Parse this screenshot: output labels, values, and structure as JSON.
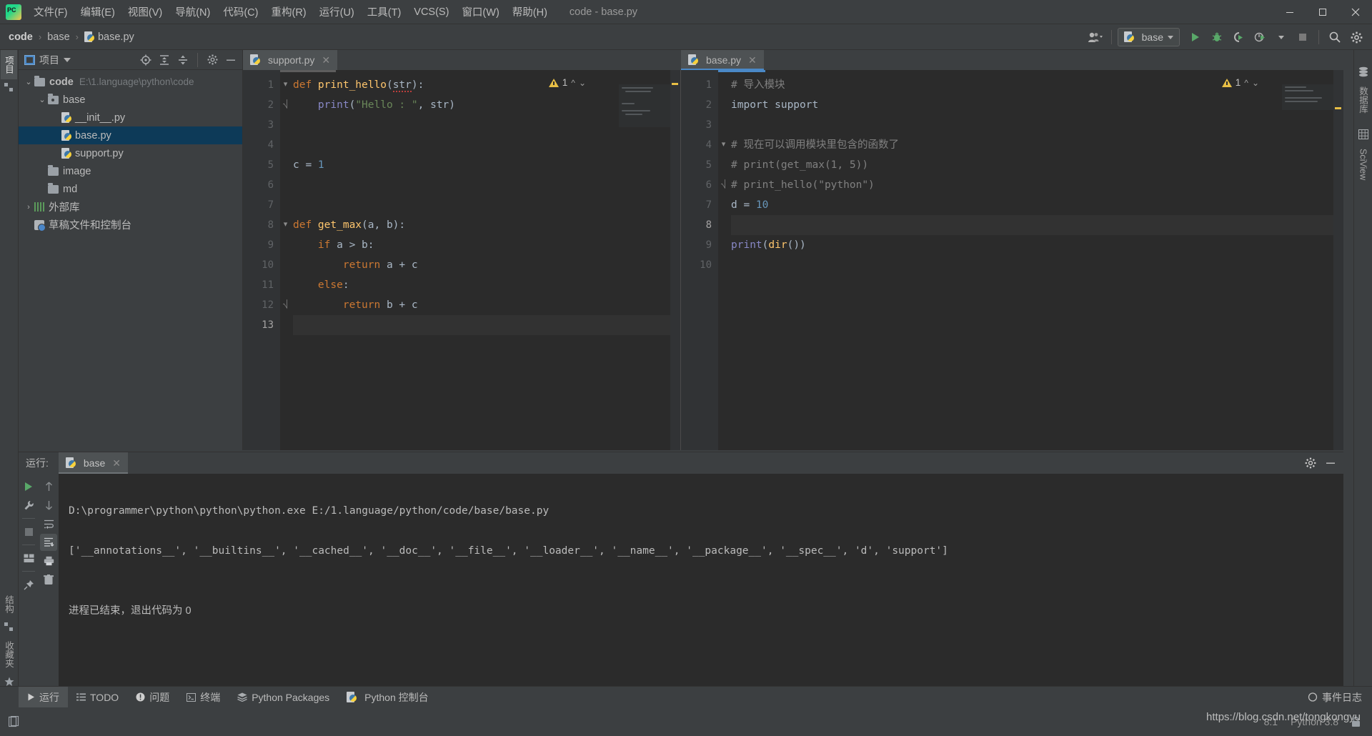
{
  "window": {
    "title": "code - base.py",
    "app_icon": "pycharm-logo-icon",
    "minimize_label": "–",
    "maximize_label": "❐",
    "close_label": "✕"
  },
  "menu": {
    "items": [
      {
        "label": "文件(F)",
        "name": "menu-file"
      },
      {
        "label": "编辑(E)",
        "name": "menu-edit"
      },
      {
        "label": "视图(V)",
        "name": "menu-view"
      },
      {
        "label": "导航(N)",
        "name": "menu-navigate"
      },
      {
        "label": "代码(C)",
        "name": "menu-code"
      },
      {
        "label": "重构(R)",
        "name": "menu-refactor"
      },
      {
        "label": "运行(U)",
        "name": "menu-run"
      },
      {
        "label": "工具(T)",
        "name": "menu-tools"
      },
      {
        "label": "VCS(S)",
        "name": "menu-vcs"
      },
      {
        "label": "窗口(W)",
        "name": "menu-window"
      },
      {
        "label": "帮助(H)",
        "name": "menu-help"
      }
    ]
  },
  "breadcrumb": {
    "root": "code",
    "folder": "base",
    "file": "base.py",
    "separator": "›"
  },
  "toolbar": {
    "run_config_label": "base",
    "buttons": [
      {
        "name": "run-button",
        "title": "Run"
      },
      {
        "name": "debug-button",
        "title": "Debug"
      },
      {
        "name": "run-with-coverage-button",
        "title": "Run with Coverage"
      },
      {
        "name": "profile-button",
        "title": "Profile"
      },
      {
        "name": "stop-button",
        "title": "Stop"
      },
      {
        "name": "search-everywhere-button",
        "title": "Search Everywhere"
      },
      {
        "name": "settings-button",
        "title": "Settings"
      }
    ]
  },
  "project_panel": {
    "title": "项目",
    "tree": [
      {
        "label": "code",
        "path": "E:\\1.language\\python\\code",
        "type": "root",
        "indent": 0,
        "expanded": true,
        "bold": true,
        "selected": false
      },
      {
        "label": "base",
        "path": "",
        "type": "source-folder",
        "indent": 1,
        "expanded": true,
        "bold": false,
        "selected": false
      },
      {
        "label": "__init__.py",
        "path": "",
        "type": "python-file",
        "indent": 2,
        "expanded": null,
        "bold": false,
        "selected": false
      },
      {
        "label": "base.py",
        "path": "",
        "type": "python-file",
        "indent": 2,
        "expanded": null,
        "bold": false,
        "selected": true
      },
      {
        "label": "support.py",
        "path": "",
        "type": "python-file",
        "indent": 2,
        "expanded": null,
        "bold": false,
        "selected": false
      },
      {
        "label": "image",
        "path": "",
        "type": "folder",
        "indent": 1,
        "expanded": null,
        "bold": false,
        "selected": false
      },
      {
        "label": "md",
        "path": "",
        "type": "folder",
        "indent": 1,
        "expanded": null,
        "bold": false,
        "selected": false
      },
      {
        "label": "外部库",
        "path": "",
        "type": "library",
        "indent": 0,
        "expanded": false,
        "bold": false,
        "selected": false
      },
      {
        "label": "草稿文件和控制台",
        "path": "",
        "type": "scratch",
        "indent": 0,
        "expanded": null,
        "bold": false,
        "selected": false
      }
    ]
  },
  "left_strip": {
    "project_tab": "项目",
    "structure_tab": "结构",
    "favorites_tab": "收藏夹"
  },
  "right_strip": {
    "database_tab": "数据库",
    "sciview_tab": "SciView"
  },
  "editor": {
    "tabs": [
      {
        "label": "support.py",
        "name": "tab-support-py",
        "active": false
      },
      {
        "label": "base.py",
        "name": "tab-base-py",
        "active": true
      }
    ],
    "left_pane": {
      "filename": "support.py",
      "warning_count": "1",
      "line_count": 13,
      "lines": [
        {
          "n": 1,
          "tokens": [
            {
              "t": "def ",
              "c": "k"
            },
            {
              "t": "print_hello",
              "c": "fn"
            },
            {
              "t": "(",
              "c": "d"
            },
            {
              "t": "str",
              "c": "err"
            },
            {
              "t": "):",
              "c": "d"
            }
          ]
        },
        {
          "n": 2,
          "tokens": [
            {
              "t": "    ",
              "c": "d"
            },
            {
              "t": "print",
              "c": "blt"
            },
            {
              "t": "(",
              "c": "d"
            },
            {
              "t": "\"Hello : \"",
              "c": "s"
            },
            {
              "t": ", str)",
              "c": "d"
            }
          ]
        },
        {
          "n": 3,
          "tokens": []
        },
        {
          "n": 4,
          "tokens": []
        },
        {
          "n": 5,
          "tokens": [
            {
              "t": "c = ",
              "c": "d"
            },
            {
              "t": "1",
              "c": "n"
            }
          ]
        },
        {
          "n": 6,
          "tokens": []
        },
        {
          "n": 7,
          "tokens": []
        },
        {
          "n": 8,
          "tokens": [
            {
              "t": "def ",
              "c": "k"
            },
            {
              "t": "get_max",
              "c": "fn"
            },
            {
              "t": "(a, b):",
              "c": "d"
            }
          ]
        },
        {
          "n": 9,
          "tokens": [
            {
              "t": "    ",
              "c": "d"
            },
            {
              "t": "if ",
              "c": "k"
            },
            {
              "t": "a > b:",
              "c": "d"
            }
          ]
        },
        {
          "n": 10,
          "tokens": [
            {
              "t": "        ",
              "c": "d"
            },
            {
              "t": "return ",
              "c": "k"
            },
            {
              "t": "a + c",
              "c": "d"
            }
          ]
        },
        {
          "n": 11,
          "tokens": [
            {
              "t": "    ",
              "c": "d"
            },
            {
              "t": "else",
              "c": "k"
            },
            {
              "t": ":",
              "c": "d"
            }
          ]
        },
        {
          "n": 12,
          "tokens": [
            {
              "t": "        ",
              "c": "d"
            },
            {
              "t": "return ",
              "c": "k"
            },
            {
              "t": "b + c",
              "c": "d"
            }
          ]
        },
        {
          "n": 13,
          "tokens": []
        }
      ],
      "current_line": 13
    },
    "right_pane": {
      "filename": "base.py",
      "warning_count": "1",
      "line_count": 10,
      "lines": [
        {
          "n": 1,
          "tokens": [
            {
              "t": "# 导入模块",
              "c": "c"
            }
          ]
        },
        {
          "n": 2,
          "tokens": [
            {
              "t": "import support",
              "c": "d"
            }
          ]
        },
        {
          "n": 3,
          "tokens": []
        },
        {
          "n": 4,
          "tokens": [
            {
              "t": "# 现在可以调用模块里包含的函数了",
              "c": "c"
            }
          ]
        },
        {
          "n": 5,
          "tokens": [
            {
              "t": "# print(get_max(1, 5))",
              "c": "c"
            }
          ]
        },
        {
          "n": 6,
          "tokens": [
            {
              "t": "# print_hello(\"python\")",
              "c": "c"
            }
          ]
        },
        {
          "n": 7,
          "tokens": [
            {
              "t": "d = ",
              "c": "d"
            },
            {
              "t": "10",
              "c": "n"
            }
          ]
        },
        {
          "n": 8,
          "tokens": []
        },
        {
          "n": 9,
          "tokens": [
            {
              "t": "print",
              "c": "blt"
            },
            {
              "t": "(",
              "c": "d"
            },
            {
              "t": "dir",
              "c": "fn"
            },
            {
              "t": "())",
              "c": "d"
            }
          ]
        },
        {
          "n": 10,
          "tokens": []
        }
      ],
      "current_line": 8
    }
  },
  "console": {
    "title": "运行:",
    "tab_label": "base",
    "output_command": "D:\\programmer\\python\\python\\python.exe E:/1.language/python/code/base/base.py",
    "output_dir_list": "['__annotations__', '__builtins__', '__cached__', '__doc__', '__file__', '__loader__', '__name__', '__package__', '__spec__', 'd', 'support']",
    "output_exit": "进程已结束，退出代码为 0",
    "toolbar_buttons": [
      {
        "name": "rerun-button",
        "glyph": "▶"
      },
      {
        "name": "edit-configurations-button",
        "glyph": "🔧"
      },
      {
        "name": "stop-process-button",
        "glyph": "■"
      },
      {
        "name": "layout-button",
        "glyph": "▤"
      },
      {
        "name": "pin-tab-button",
        "glyph": "📌"
      }
    ],
    "toolbar2_buttons": [
      {
        "name": "up-stack-trace-button",
        "glyph": "↑"
      },
      {
        "name": "down-stack-trace-button",
        "glyph": "↓"
      },
      {
        "name": "soft-wrap-button",
        "glyph": "↵"
      },
      {
        "name": "scroll-to-end-button",
        "glyph": "⤓"
      },
      {
        "name": "print-button",
        "glyph": "🖨"
      },
      {
        "name": "clear-all-button",
        "glyph": "🗑"
      }
    ],
    "settings_label": "⚙",
    "hide_label": "—"
  },
  "bottom_bar": {
    "items": [
      {
        "label": "运行",
        "name": "bottom-tab-run",
        "icon": "play-icon",
        "active": true
      },
      {
        "label": "TODO",
        "name": "bottom-tab-todo",
        "icon": "list-icon",
        "active": false
      },
      {
        "label": "问题",
        "name": "bottom-tab-problems",
        "icon": "exclamation-icon",
        "active": false
      },
      {
        "label": "终端",
        "name": "bottom-tab-terminal",
        "icon": "terminal-icon",
        "active": false
      },
      {
        "label": "Python Packages",
        "name": "bottom-tab-python-packages",
        "icon": "stack-icon",
        "active": false
      },
      {
        "label": "Python 控制台",
        "name": "bottom-tab-python-console",
        "icon": "python-icon",
        "active": false
      }
    ],
    "event_log": "事件日志"
  },
  "status_bar": {
    "caret_position": "8:1",
    "interpreter": "Python 3.8",
    "watermark": "https://blog.csdn.net/tongkongyu"
  },
  "colors": {
    "accent_blue": "#4a88c7",
    "selection_blue": "#0d3a58",
    "warning_yellow": "#e8bf45",
    "run_green": "#59a869",
    "editor_bg": "#2b2b2b",
    "panel_bg": "#3c3f41"
  }
}
